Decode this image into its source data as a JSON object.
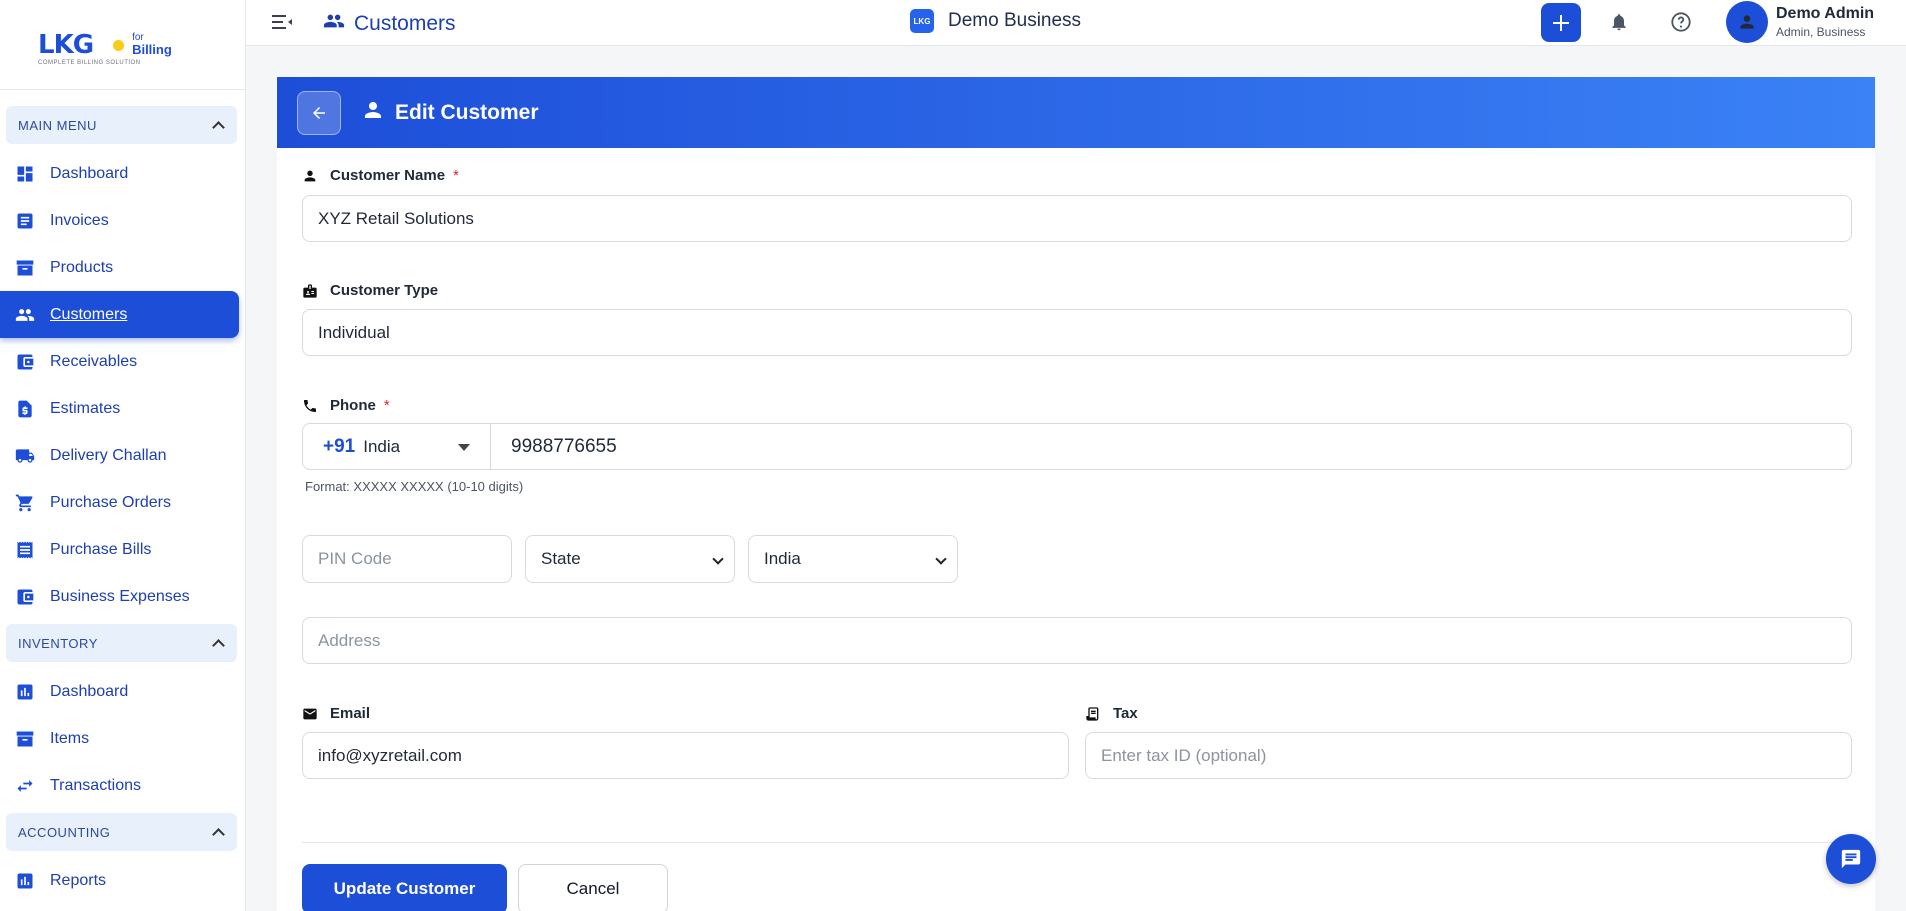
{
  "brand": {
    "name": "LKG",
    "for": "for",
    "billing": "Billing",
    "tagline": "COMPLETE BILLING SOLUTION"
  },
  "sidebar": {
    "sections": [
      {
        "title": "MAIN MENU",
        "items": [
          {
            "label": "Dashboard",
            "icon": "dashboard-icon"
          },
          {
            "label": "Invoices",
            "icon": "invoice-icon"
          },
          {
            "label": "Products",
            "icon": "archive-icon"
          },
          {
            "label": "Customers",
            "icon": "people-icon",
            "active": true
          },
          {
            "label": "Receivables",
            "icon": "wallet-icon"
          },
          {
            "label": "Estimates",
            "icon": "dollar-doc-icon"
          },
          {
            "label": "Delivery Challan",
            "icon": "truck-icon"
          },
          {
            "label": "Purchase Orders",
            "icon": "cart-icon"
          },
          {
            "label": "Purchase Bills",
            "icon": "receipt-icon"
          },
          {
            "label": "Business Expenses",
            "icon": "wallet-icon"
          }
        ]
      },
      {
        "title": "INVENTORY",
        "items": [
          {
            "label": "Dashboard",
            "icon": "bar-chart-icon"
          },
          {
            "label": "Items",
            "icon": "archive-icon"
          },
          {
            "label": "Transactions",
            "icon": "swap-icon"
          }
        ]
      },
      {
        "title": "ACCOUNTING",
        "items": [
          {
            "label": "Reports",
            "icon": "bar-chart-icon"
          }
        ]
      }
    ]
  },
  "topbar": {
    "page_title": "Customers",
    "business_logo": "LKG",
    "business_name": "Demo Business",
    "user_name": "Demo Admin",
    "user_role": "Admin, Business"
  },
  "form": {
    "title": "Edit Customer",
    "customer_name_label": "Customer Name",
    "required_mark": "*",
    "customer_name_value": "XYZ Retail Solutions",
    "customer_type_label": "Customer Type",
    "customer_type_value": "Individual",
    "phone_label": "Phone",
    "phone_code": "+91",
    "phone_country": "India",
    "phone_value": "9988776655",
    "phone_hint": "Format: XXXXX XXXXX (10-10 digits)",
    "pin_placeholder": "PIN Code",
    "state_value": "State",
    "country_value": "India",
    "address_placeholder": "Address",
    "email_label": "Email",
    "email_value": "info@xyzretail.com",
    "tax_label": "Tax",
    "tax_placeholder": "Enter tax ID (optional)",
    "update_button": "Update Customer",
    "cancel_button": "Cancel"
  },
  "colors": {
    "primary": "#1d4ed8",
    "accent_light": "#3b82f6",
    "required": "#dc2626"
  }
}
